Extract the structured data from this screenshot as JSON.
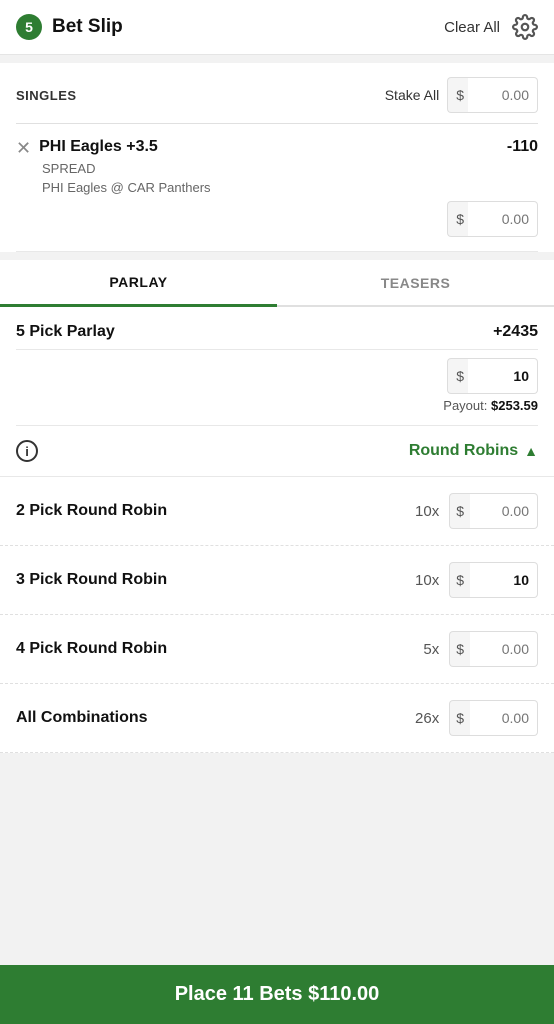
{
  "header": {
    "badge_count": "5",
    "title": "Bet Slip",
    "clear_all": "Clear All"
  },
  "singles": {
    "label": "SINGLES",
    "stake_all": "Stake All",
    "dollar": "$",
    "stake_placeholder": "0.00",
    "bet": {
      "title": "PHI Eagles +3.5",
      "odds": "-110",
      "type": "SPREAD",
      "matchup": "PHI Eagles @ CAR Panthers",
      "stake_placeholder": "0.00"
    }
  },
  "tabs": {
    "parlay": "PARLAY",
    "teasers": "TEASERS"
  },
  "parlay": {
    "title": "5 Pick Parlay",
    "odds": "+2435",
    "dollar": "$",
    "stake_value": "10",
    "payout_label": "Payout:",
    "payout_amount": "$253.59"
  },
  "round_robins": {
    "label": "Round Robins",
    "chevron": "▲",
    "info": "i",
    "rows": [
      {
        "title": "2 Pick Round Robin",
        "multiplier": "10x",
        "dollar": "$",
        "placeholder": "0.00",
        "value": "",
        "filled": false
      },
      {
        "title": "3 Pick Round Robin",
        "multiplier": "10x",
        "dollar": "$",
        "placeholder": "",
        "value": "10",
        "filled": true
      },
      {
        "title": "4 Pick Round Robin",
        "multiplier": "5x",
        "dollar": "$",
        "placeholder": "0.00",
        "value": "",
        "filled": false
      },
      {
        "title": "All Combinations",
        "multiplier": "26x",
        "dollar": "$",
        "placeholder": "0.00",
        "value": "",
        "filled": false
      }
    ]
  },
  "place_bets": {
    "label": "Place 11 Bets $110.00"
  }
}
